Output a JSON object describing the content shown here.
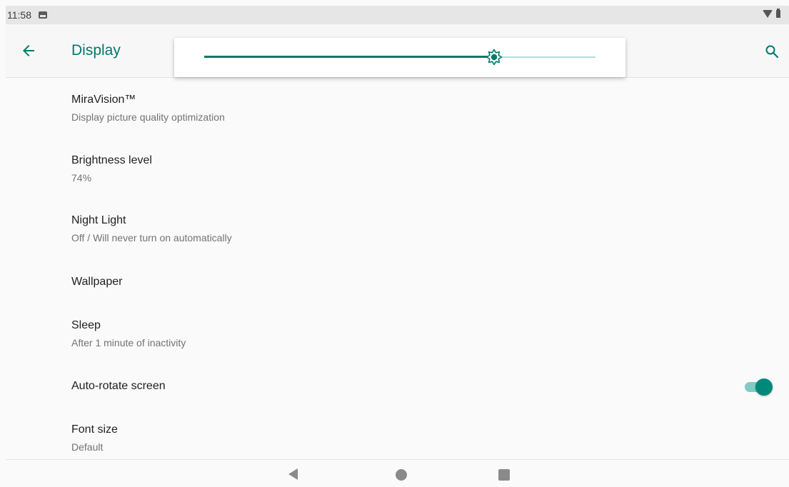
{
  "status_bar": {
    "time": "11:58"
  },
  "app_bar": {
    "title": "Display"
  },
  "brightness": {
    "level": 0.74
  },
  "settings": [
    {
      "title": "MiraVision™",
      "summary": "Display picture quality optimization"
    },
    {
      "title": "Brightness level",
      "summary": "74%"
    },
    {
      "title": "Night Light",
      "summary": "Off / Will never turn on automatically"
    },
    {
      "title": "Wallpaper",
      "summary": ""
    },
    {
      "title": "Sleep",
      "summary": "After 1 minute of inactivity"
    },
    {
      "title": "Auto-rotate screen",
      "summary": "",
      "toggle_on": true
    },
    {
      "title": "Font size",
      "summary": "Default"
    }
  ],
  "colors": {
    "accent": "#00796b",
    "track_light": "#b2dfdb"
  },
  "icons": [
    "image-icon",
    "wifi-icon",
    "battery-icon",
    "back-arrow-icon",
    "search-icon",
    "brightness-icon",
    "nav-back-icon",
    "nav-home-icon",
    "nav-recents-icon"
  ]
}
